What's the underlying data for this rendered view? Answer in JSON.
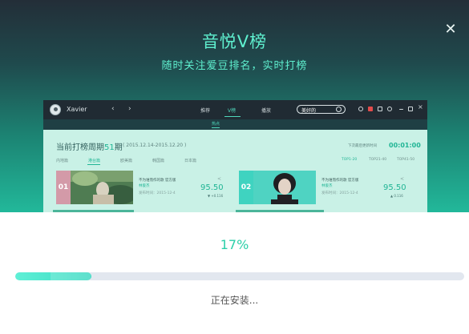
{
  "hero": {
    "title": "音悦V榜",
    "subtitle": "随时关注爱豆排名，实时打榜",
    "close_icon": "close-icon"
  },
  "preview": {
    "username": "Xavier",
    "top_tabs": [
      "推荐",
      "V榜",
      "播放"
    ],
    "active_top_tab": "V榜",
    "search_value": "美好的",
    "sub_tab": "热点",
    "period_prefix": "当前打榜周期",
    "period_number": "51",
    "period_suffix": "期",
    "period_range": "( 2015.12.14-2015.12.20 )",
    "countdown_label": "下次最后更新时间",
    "countdown": "00:01:00",
    "regions": [
      "内地篇",
      "港台篇",
      "欧美篇",
      "韩国篇",
      "日本篇"
    ],
    "active_region": "港台篇",
    "ranges": [
      "TOP1-20",
      "TOP21-40",
      "TOP41-50"
    ],
    "active_range": "TOP1-20",
    "cards": [
      {
        "rank": "01",
        "title": "不为谁而作的歌 官方版",
        "artist": "林俊杰",
        "date": "发布时间：2015-12-4",
        "score": "95.50",
        "change": "▼ +0.116"
      },
      {
        "rank": "02",
        "title": "不为谁而作的歌 官方版",
        "artist": "林俊杰",
        "date": "发布时间：2015-12-4",
        "score": "95.50",
        "change": "▲ 0.116"
      }
    ]
  },
  "install": {
    "progress_percent": 17,
    "progress_label": "17%",
    "status": "正在安装..."
  },
  "colors": {
    "accent": "#2bcfa8",
    "progress_fill": "#4fe3cc",
    "progress_track": "#e2e7ef"
  }
}
